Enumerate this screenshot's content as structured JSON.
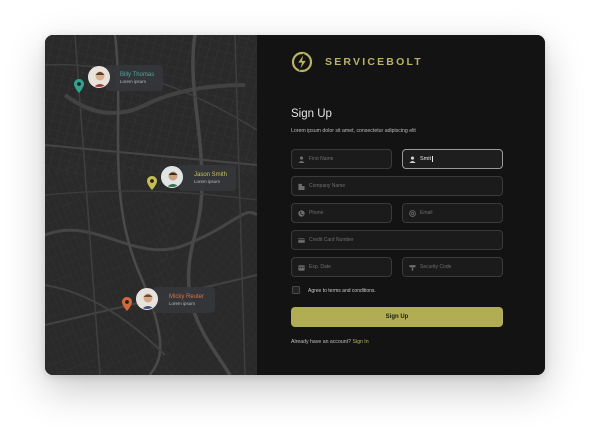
{
  "brand": {
    "name": "SERVICEBOLT",
    "logo_icon": "bolt-circle-icon",
    "accent": "#b8b462"
  },
  "map": {
    "users": [
      {
        "name": "Billy Thomas",
        "subtitle": "Lorem ipsum",
        "name_color": "#4fa89a",
        "pin_color": "#2fa38e",
        "avatar_bg": "#d8b79b"
      },
      {
        "name": "Jason Smith",
        "subtitle": "Lorem ipsum",
        "name_color": "#c9c15a",
        "pin_color": "#c7bf4c",
        "avatar_bg": "#c9a98c"
      },
      {
        "name": "Micky Reuter",
        "subtitle": "Lorem ipsum",
        "name_color": "#d2744a",
        "pin_color": "#d2683c",
        "avatar_bg": "#caa57f"
      }
    ]
  },
  "form": {
    "title": "Sign Up",
    "subtitle": "Lorem ipsum dolor sit amet, consectetur adipiscing elit",
    "first_name_placeholder": "First Name",
    "last_name_value": "Smit",
    "company_placeholder": "Company Name",
    "phone_placeholder": "Phone",
    "email_placeholder": "Email",
    "card_placeholder": "Credit Card Number",
    "exp_placeholder": "Exp. Date",
    "security_placeholder": "Security Code",
    "agree_label": "Agree to terms and conditions.",
    "signup_button": "Sign Up",
    "already_text": "Already have an account?",
    "signin_link": "Sign In",
    "button_color": "#b1ad53"
  }
}
